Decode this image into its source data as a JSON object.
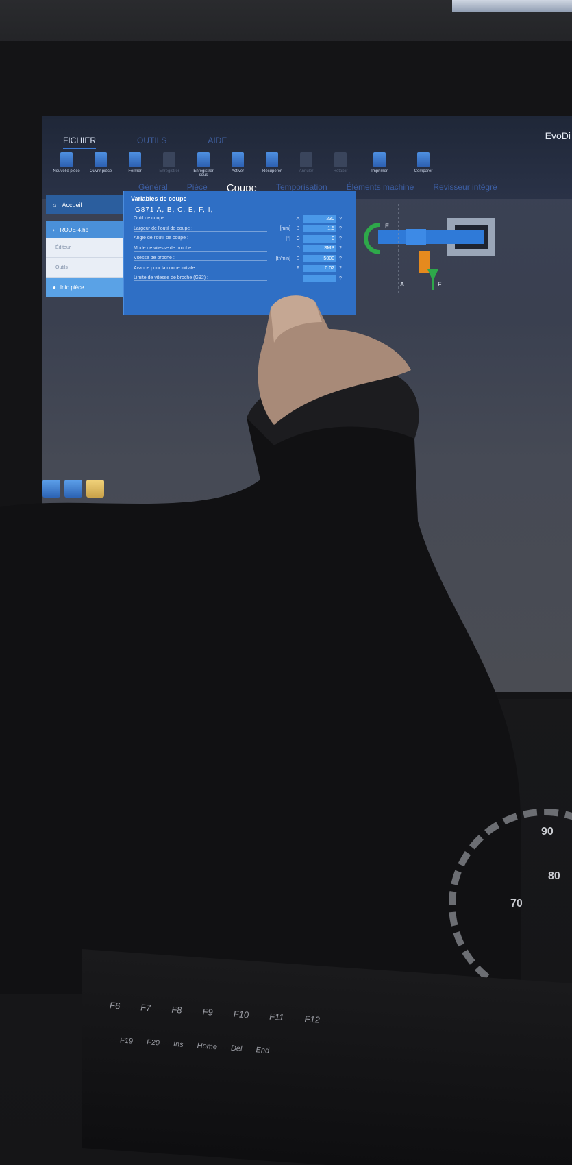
{
  "window": {
    "app_name": "EvoDi"
  },
  "menu_tabs": [
    "FICHIER",
    "OUTILS",
    "AIDE"
  ],
  "toolbar": [
    {
      "label": "Nouvelle pièce",
      "icon": "new-file-icon"
    },
    {
      "label": "Ouvrir pièce",
      "icon": "open-file-icon"
    },
    {
      "label": "Fermer",
      "icon": "close-file-icon"
    },
    {
      "label": "Enregistrer",
      "icon": "save-icon"
    },
    {
      "label": "Enregistrer sous",
      "icon": "save-as-icon"
    },
    {
      "label": "Activer",
      "icon": "activate-icon"
    },
    {
      "label": "Récupérer",
      "icon": "retrieve-icon"
    },
    {
      "label": "Annuler",
      "icon": "undo-icon"
    },
    {
      "label": "Rétablir",
      "icon": "redo-icon"
    },
    {
      "label": "Imprimer",
      "icon": "printer-icon"
    },
    {
      "label": "Comparer",
      "icon": "compare-icon"
    }
  ],
  "sub_tabs": [
    "Général",
    "Pièce",
    "Coupe",
    "Temporisation",
    "Éléments machine",
    "Revisseur intégré"
  ],
  "sidebar": {
    "home": "Accueil",
    "file": "ROUE-4.hp",
    "items": [
      "Éditeur",
      "Outils"
    ],
    "info": "Info pièce"
  },
  "panel": {
    "title": "Variables de coupe",
    "gcode": "G871  A,  B,  C,       E,  F,  I,",
    "rows": [
      {
        "label": "Outil de coupe :",
        "unit": "",
        "symbol": "A",
        "value": "230"
      },
      {
        "label": "Largeur de l'outil de coupe :",
        "unit": "[mm]",
        "symbol": "B",
        "value": "1.5"
      },
      {
        "label": "Angle de l'outil de coupe :",
        "unit": "[°]",
        "symbol": "C",
        "value": "0"
      },
      {
        "label": "Mode de vitesse de broche :",
        "unit": "",
        "symbol": "D",
        "value": "SMP"
      },
      {
        "label": "Vitesse de broche :",
        "unit": "[tr/min]",
        "symbol": "E",
        "value": "5000"
      },
      {
        "label": "Avance pour la coupe initiale :",
        "unit": "",
        "symbol": "F",
        "value": "0.02"
      },
      {
        "label": "Limite de vitesse de broche (G92) :",
        "unit": "",
        "symbol": "",
        "value": ""
      }
    ]
  },
  "diagram": {
    "labels": [
      "E",
      "A",
      "F"
    ]
  },
  "dial_numbers": [
    "90",
    "80",
    "70"
  ],
  "keyboard": {
    "row1": [
      "F6",
      "F7",
      "F8",
      "F9",
      "F10",
      "F11",
      "F12"
    ],
    "row2": [
      "F19",
      "F20",
      "Ins",
      "Home",
      "Del",
      "End"
    ]
  }
}
